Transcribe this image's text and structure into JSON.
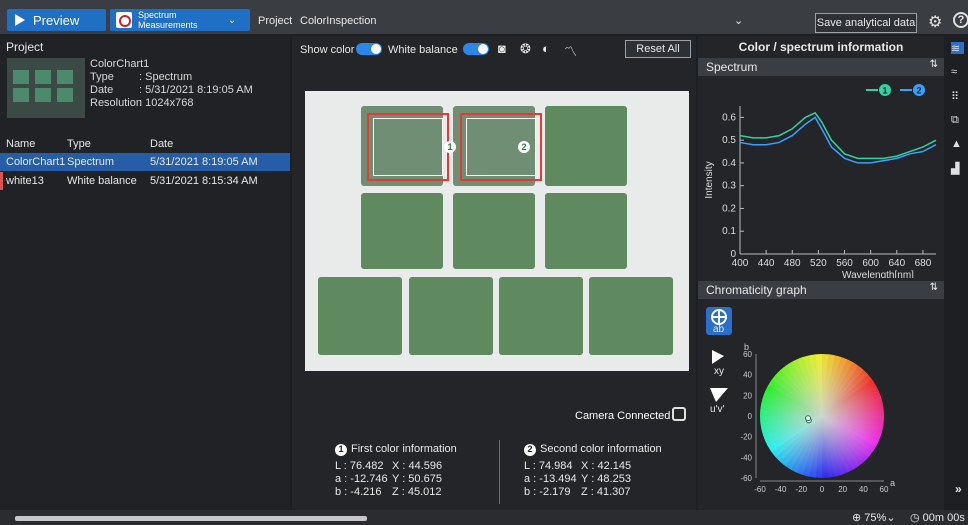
{
  "topbar": {
    "preview_label": "Preview",
    "mode_label": "Spectrum Measurements",
    "project_label": "Project",
    "project_name": "ColorInspection",
    "save_label": "Save analytical data"
  },
  "left": {
    "title": "Project",
    "meta": {
      "name": "ColorChart1",
      "type_key": "Type",
      "type_val": ": Spectrum",
      "date_key": "Date",
      "date_val": ": 5/31/2021 8:19:05 AM",
      "res_key": "Resolution",
      "res_val": ": 1024x768"
    },
    "columns": [
      "Name",
      "Type",
      "Date"
    ],
    "rows": [
      {
        "name": "ColorChart1",
        "type": "Spectrum",
        "date": "5/31/2021 8:19:05 AM"
      },
      {
        "name": "white13",
        "type": "White balance",
        "date": "5/31/2021 8:15:34 AM"
      }
    ]
  },
  "center": {
    "show_color": "Show color",
    "white_balance": "White balance",
    "reset": "Reset All",
    "camera": "Camera Connected",
    "roi1": "1",
    "roi2": "2",
    "first": {
      "title": "First color information",
      "badge": "1",
      "L": "L : 76.482",
      "X": "X : 44.596",
      "a": "a : -12.746",
      "Y": "Y : 50.675",
      "b": "b : -4.216",
      "Z": "Z : 45.012"
    },
    "second": {
      "title": "Second color information",
      "badge": "2",
      "L": "L : 74.984",
      "X": "X : 42.145",
      "a": "a : -13.494",
      "Y": "Y : 48.253",
      "b": "b : -2.179",
      "Z": "Z : 41.307"
    }
  },
  "right": {
    "title": "Color / spectrum information",
    "spectrum_title": "Spectrum",
    "chroma_title": "Chromaticity graph",
    "modes": [
      "ab",
      "xy",
      "u'v'"
    ]
  },
  "chart_data": {
    "type": "line",
    "xlabel": "Wavelength[nm]",
    "ylabel": "Intensity",
    "xlim": [
      400,
      700
    ],
    "ylim": [
      0,
      0.65
    ],
    "xticks": [
      400,
      440,
      480,
      520,
      560,
      600,
      640,
      680
    ],
    "yticks": [
      0,
      0.1,
      0.2,
      0.3,
      0.4,
      0.5,
      0.6
    ],
    "series": [
      {
        "name": "1",
        "color": "#2ed3a0",
        "x": [
          400,
          420,
          440,
          460,
          480,
          500,
          515,
          525,
          540,
          560,
          580,
          600,
          620,
          640,
          660,
          680,
          700
        ],
        "y": [
          0.52,
          0.51,
          0.51,
          0.52,
          0.55,
          0.6,
          0.62,
          0.58,
          0.5,
          0.44,
          0.42,
          0.42,
          0.42,
          0.43,
          0.45,
          0.47,
          0.5
        ]
      },
      {
        "name": "2",
        "color": "#3aa0ff",
        "x": [
          400,
          420,
          440,
          460,
          480,
          500,
          515,
          525,
          540,
          560,
          580,
          600,
          620,
          640,
          660,
          680,
          700
        ],
        "y": [
          0.49,
          0.48,
          0.48,
          0.49,
          0.52,
          0.57,
          0.6,
          0.55,
          0.47,
          0.42,
          0.4,
          0.4,
          0.41,
          0.42,
          0.44,
          0.45,
          0.48
        ]
      }
    ]
  },
  "chroma": {
    "x_axis": "a",
    "y_axis": "b",
    "xticks": [
      -60,
      -40,
      -20,
      0,
      20,
      40,
      60
    ],
    "yticks": [
      60,
      40,
      20,
      0,
      -20,
      -40,
      -60
    ],
    "points": [
      {
        "a": -12.746,
        "b": -4.216,
        "id": "1"
      },
      {
        "a": -13.494,
        "b": -2.179,
        "id": "2"
      }
    ]
  },
  "bottom": {
    "zoom": "75%",
    "timer": "00m 00s",
    "progress": 0.37
  },
  "colors": {
    "accent": "#1f6fc4",
    "roi": "#e53935"
  }
}
